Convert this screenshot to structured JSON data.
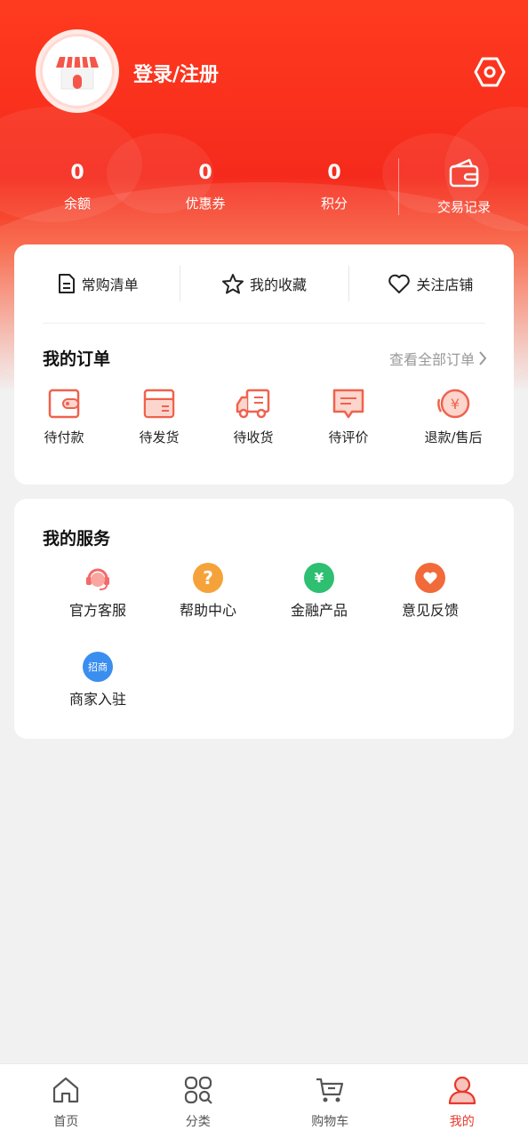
{
  "header": {
    "login_label": "登录/注册",
    "stats": [
      {
        "value": "0",
        "label": "余额"
      },
      {
        "value": "0",
        "label": "优惠券"
      },
      {
        "value": "0",
        "label": "积分"
      }
    ],
    "transactions_label": "交易记录"
  },
  "quick_links": [
    {
      "label": "常购清单",
      "icon": "list-icon"
    },
    {
      "label": "我的收藏",
      "icon": "star-icon"
    },
    {
      "label": "关注店铺",
      "icon": "heart-icon"
    }
  ],
  "orders": {
    "title": "我的订单",
    "view_all": "查看全部订单",
    "items": [
      {
        "label": "待付款",
        "icon": "wallet-icon"
      },
      {
        "label": "待发货",
        "icon": "box-icon"
      },
      {
        "label": "待收货",
        "icon": "truck-icon"
      },
      {
        "label": "待评价",
        "icon": "comment-icon"
      },
      {
        "label": "退款/售后",
        "icon": "refund-icon"
      }
    ]
  },
  "services": {
    "title": "我的服务",
    "items": [
      {
        "label": "官方客服",
        "icon": "headset-icon",
        "color": "#f46a6a"
      },
      {
        "label": "帮助中心",
        "icon": "question-icon",
        "color": "#f6a23a",
        "glyph": "?"
      },
      {
        "label": "金融产品",
        "icon": "finance-icon",
        "color": "#2fbf71",
        "glyph": "¥"
      },
      {
        "label": "意见反馈",
        "icon": "feedback-icon",
        "color": "#f26a3a"
      },
      {
        "label": "商家入驻",
        "icon": "merchant-icon",
        "color": "#3a8ef0",
        "glyph": "招商"
      }
    ]
  },
  "tabbar": [
    {
      "label": "首页",
      "icon": "home-icon"
    },
    {
      "label": "分类",
      "icon": "category-icon"
    },
    {
      "label": "购物车",
      "icon": "cart-icon"
    },
    {
      "label": "我的",
      "icon": "user-icon",
      "active": true
    }
  ],
  "colors": {
    "brand": "#f52a1c",
    "accent_icon": "#f0624d",
    "active_tab": "#e8382c"
  }
}
